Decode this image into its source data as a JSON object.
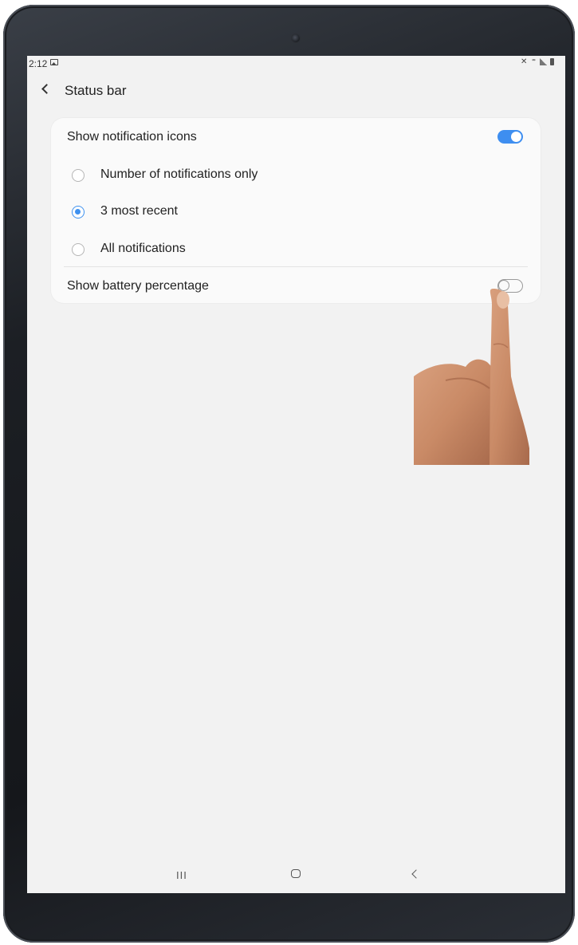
{
  "status_bar": {
    "time": "2:12",
    "icons": [
      "gallery-icon",
      "mute-icon",
      "wifi-icon",
      "signal-icon",
      "battery-icon"
    ]
  },
  "header": {
    "back_icon": "chevron-left-icon",
    "title": "Status bar"
  },
  "settings": {
    "show_notification_icons": {
      "label": "Show notification icons",
      "enabled": true
    },
    "notification_options": [
      {
        "label": "Number of notifications only",
        "selected": false
      },
      {
        "label": "3 most recent",
        "selected": true
      },
      {
        "label": "All notifications",
        "selected": false
      }
    ],
    "show_battery_percentage": {
      "label": "Show battery percentage",
      "enabled": false
    }
  },
  "nav_bar": {
    "recents": "III",
    "home_icon": "home-icon",
    "back_icon": "back-icon"
  },
  "colors": {
    "accent": "#3e8ef0",
    "screen_bg": "#f2f2f2",
    "card_bg": "#fafafa"
  }
}
